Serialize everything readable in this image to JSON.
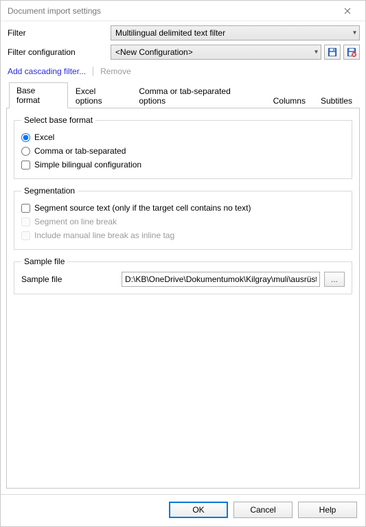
{
  "window": {
    "title": "Document import settings"
  },
  "filter": {
    "label": "Filter",
    "selected": "Multilingual delimited text filter"
  },
  "filter_config": {
    "label": "Filter configuration",
    "selected": "<New Configuration>"
  },
  "links": {
    "add_cascading": "Add cascading filter...",
    "remove": "Remove"
  },
  "tabs": {
    "base_format": "Base format",
    "excel_options": "Excel options",
    "csv_options": "Comma or tab-separated options",
    "columns": "Columns",
    "subtitles": "Subtitles"
  },
  "base_format_group": {
    "legend": "Select base format",
    "excel": "Excel",
    "csv": "Comma or tab-separated",
    "simple_bilingual": "Simple bilingual configuration"
  },
  "segmentation_group": {
    "legend": "Segmentation",
    "segment_source": "Segment source text (only if the target cell contains no text)",
    "segment_linebreak": "Segment on line break",
    "inline_tag": "Include manual line break as inline tag"
  },
  "sample_group": {
    "legend": "Sample file",
    "label": "Sample file",
    "path": "D:\\KB\\OneDrive\\Dokumentumok\\Kilgray\\muli\\ausrüstung.xlsx",
    "browse": "..."
  },
  "buttons": {
    "ok": "OK",
    "cancel": "Cancel",
    "help": "Help"
  }
}
